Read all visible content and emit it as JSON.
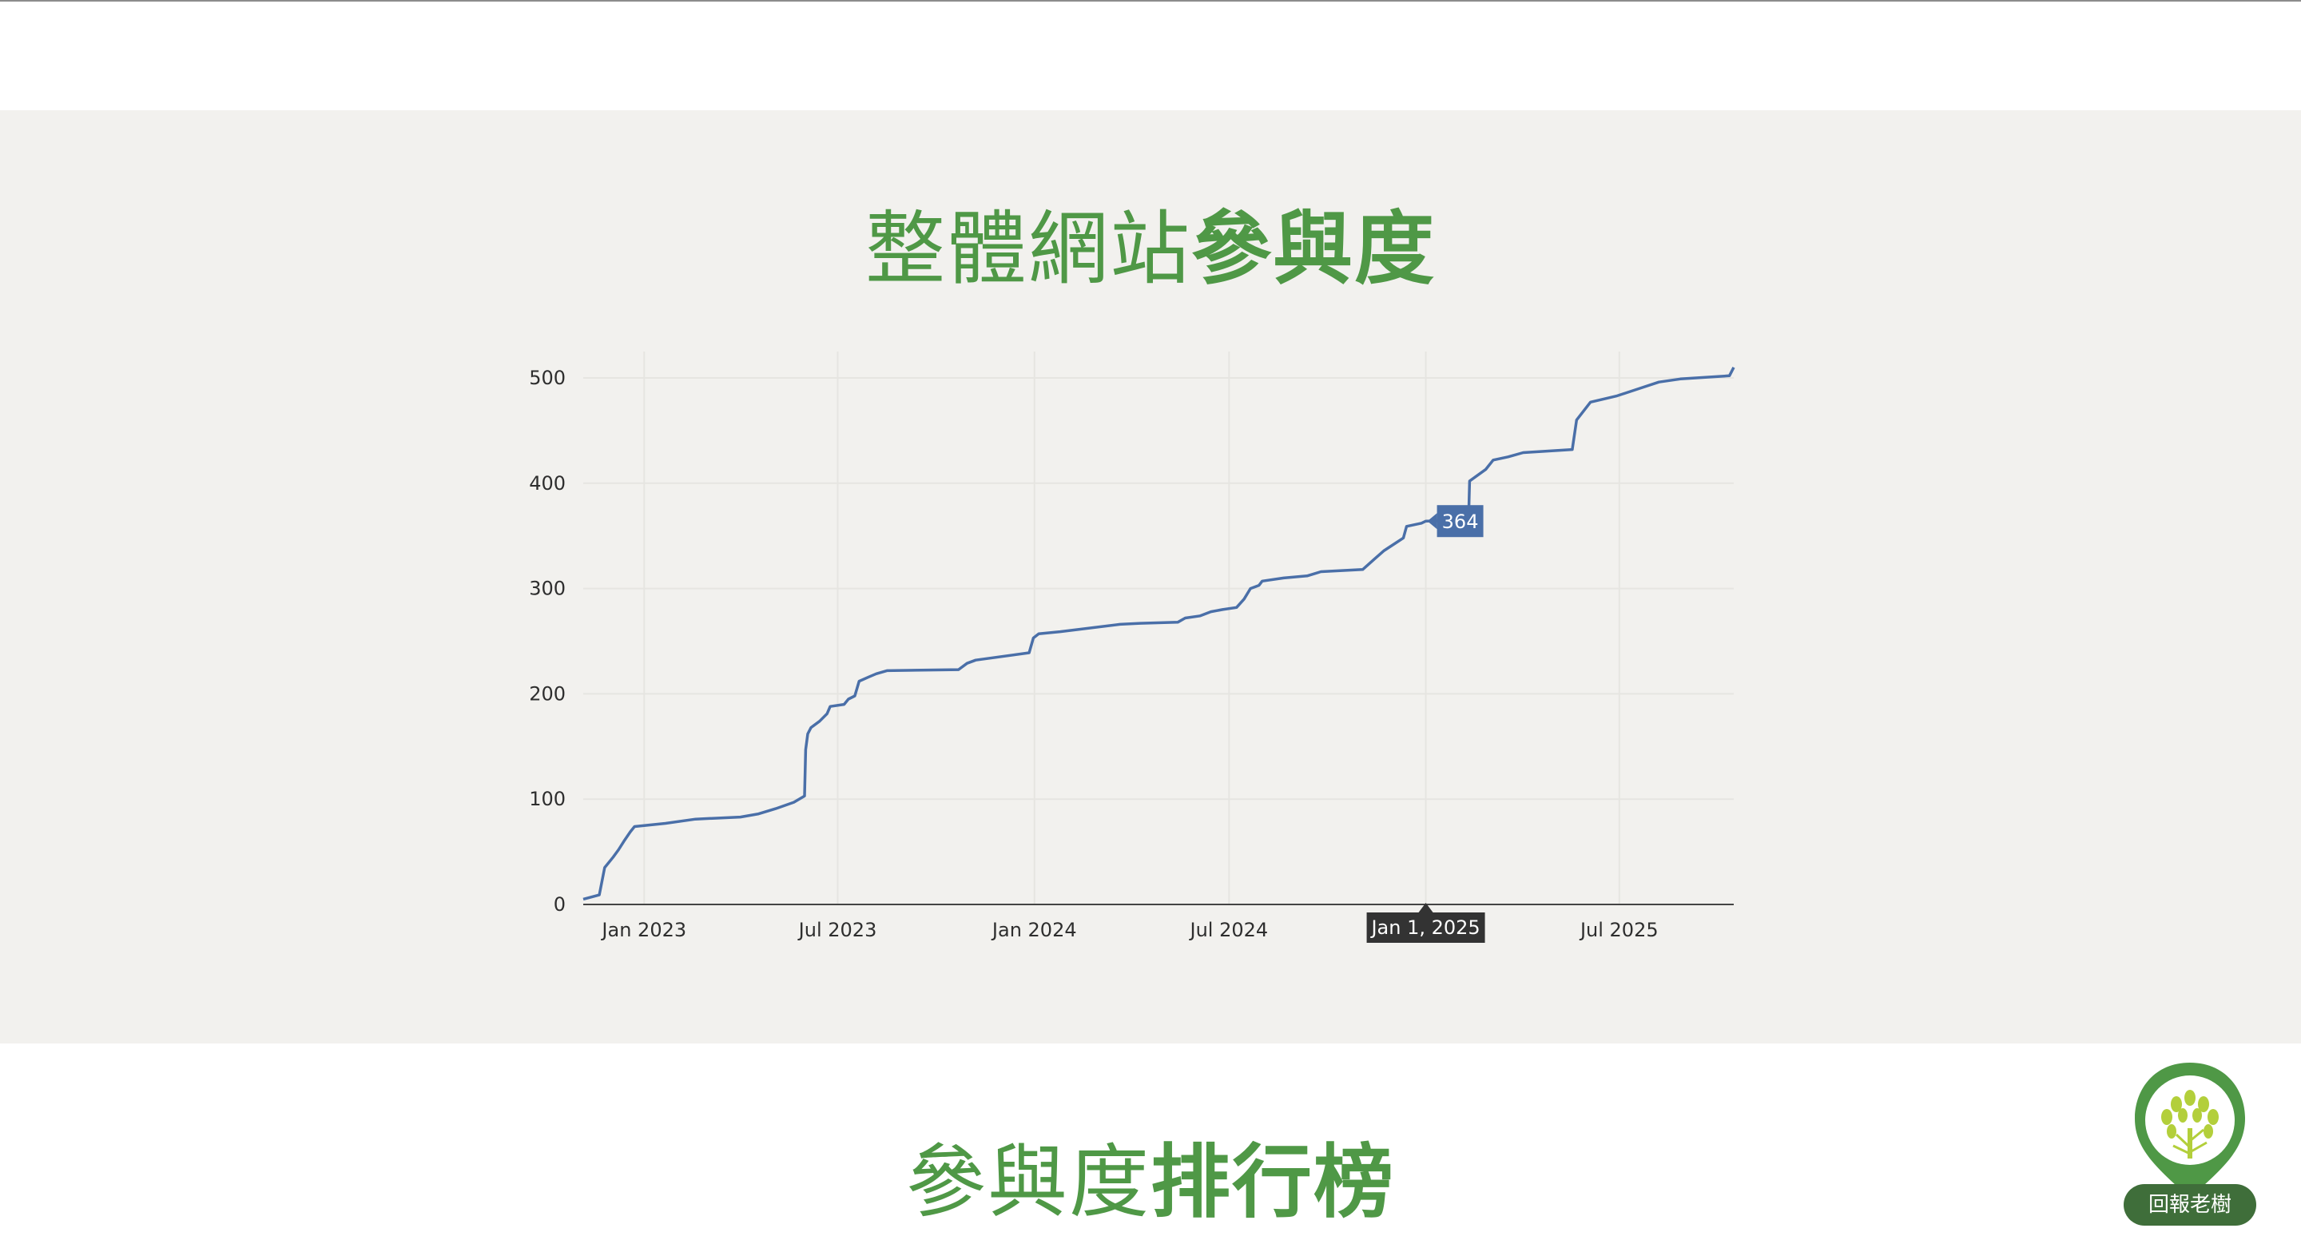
{
  "sections": {
    "participation": {
      "title_light": "整體網站",
      "title_bold": "參與度"
    },
    "ranking": {
      "title_light": "參與度",
      "title_bold": "排行榜"
    }
  },
  "badge": {
    "label": "回報老樹",
    "icon": "tree-icon"
  },
  "colors": {
    "accent": "#4f9846",
    "line": "#4a6fa8",
    "band": "#f2f1ee",
    "tooltip": "#333333",
    "badge": "#3f6e3a"
  },
  "chart_data": {
    "type": "line",
    "title": "",
    "xlabel": "",
    "ylabel": "",
    "x_tick_labels": [
      {
        "date": "2023-01-01",
        "label": "Jan 2023"
      },
      {
        "date": "2023-07-01",
        "label": "Jul 2023"
      },
      {
        "date": "2024-01-01",
        "label": "Jan 2024"
      },
      {
        "date": "2024-07-01",
        "label": "Jul 2024"
      },
      {
        "date": "2025-07-01",
        "label": "Jul 2025"
      }
    ],
    "y_ticks": [
      0,
      100,
      200,
      300,
      400,
      500
    ],
    "xlim": [
      "2022-11-05",
      "2025-10-16"
    ],
    "ylim": [
      0,
      525
    ],
    "grid": true,
    "hover": {
      "x": "2025-01-01",
      "x_label": "Jan 1, 2025",
      "y": 364,
      "y_label": "364"
    },
    "series": [
      {
        "points": [
          [
            "2022-11-05",
            5
          ],
          [
            "2022-11-20",
            9
          ],
          [
            "2022-11-25",
            35
          ],
          [
            "2022-12-03",
            45
          ],
          [
            "2022-12-08",
            52
          ],
          [
            "2022-12-13",
            60
          ],
          [
            "2022-12-19",
            69
          ],
          [
            "2022-12-23",
            74
          ],
          [
            "2023-01-21",
            77
          ],
          [
            "2023-02-18",
            81
          ],
          [
            "2023-04-01",
            83
          ],
          [
            "2023-04-18",
            86
          ],
          [
            "2023-05-04",
            91
          ],
          [
            "2023-05-21",
            97
          ],
          [
            "2023-05-31",
            103
          ],
          [
            "2023-06-01",
            147
          ],
          [
            "2023-06-03",
            162
          ],
          [
            "2023-06-06",
            168
          ],
          [
            "2023-06-14",
            174
          ],
          [
            "2023-06-21",
            181
          ],
          [
            "2023-06-24",
            188
          ],
          [
            "2023-07-07",
            190
          ],
          [
            "2023-07-11",
            195
          ],
          [
            "2023-07-17",
            198
          ],
          [
            "2023-07-21",
            212
          ],
          [
            "2023-07-30",
            216
          ],
          [
            "2023-08-06",
            219
          ],
          [
            "2023-08-16",
            222
          ],
          [
            "2023-10-22",
            223
          ],
          [
            "2023-10-30",
            229
          ],
          [
            "2023-11-07",
            232
          ],
          [
            "2023-12-27",
            239
          ],
          [
            "2023-12-31",
            253
          ],
          [
            "2024-01-05",
            257
          ],
          [
            "2024-01-25",
            259
          ],
          [
            "2024-03-21",
            266
          ],
          [
            "2024-04-09",
            267
          ],
          [
            "2024-05-14",
            268
          ],
          [
            "2024-05-21",
            272
          ],
          [
            "2024-06-04",
            274
          ],
          [
            "2024-06-14",
            278
          ],
          [
            "2024-06-25",
            280
          ],
          [
            "2024-07-08",
            282
          ],
          [
            "2024-07-15",
            290
          ],
          [
            "2024-07-21",
            300
          ],
          [
            "2024-07-29",
            303
          ],
          [
            "2024-08-01",
            307
          ],
          [
            "2024-08-21",
            310
          ],
          [
            "2024-09-12",
            312
          ],
          [
            "2024-09-25",
            316
          ],
          [
            "2024-11-03",
            318
          ],
          [
            "2024-11-14",
            328
          ],
          [
            "2024-11-23",
            336
          ],
          [
            "2024-12-05",
            344
          ],
          [
            "2024-12-11",
            348
          ],
          [
            "2024-12-14",
            359
          ],
          [
            "2024-12-28",
            362
          ],
          [
            "2025-01-01",
            364
          ],
          [
            "2025-02-10",
            365
          ],
          [
            "2025-02-11",
            402
          ],
          [
            "2025-02-26",
            413
          ],
          [
            "2025-03-05",
            422
          ],
          [
            "2025-03-19",
            425
          ],
          [
            "2025-04-02",
            429
          ],
          [
            "2025-05-18",
            432
          ],
          [
            "2025-05-22",
            460
          ],
          [
            "2025-06-04",
            477
          ],
          [
            "2025-06-29",
            483
          ],
          [
            "2025-07-20",
            490
          ],
          [
            "2025-08-07",
            496
          ],
          [
            "2025-08-27",
            499
          ],
          [
            "2025-10-12",
            502
          ],
          [
            "2025-10-16",
            510
          ]
        ]
      }
    ]
  }
}
